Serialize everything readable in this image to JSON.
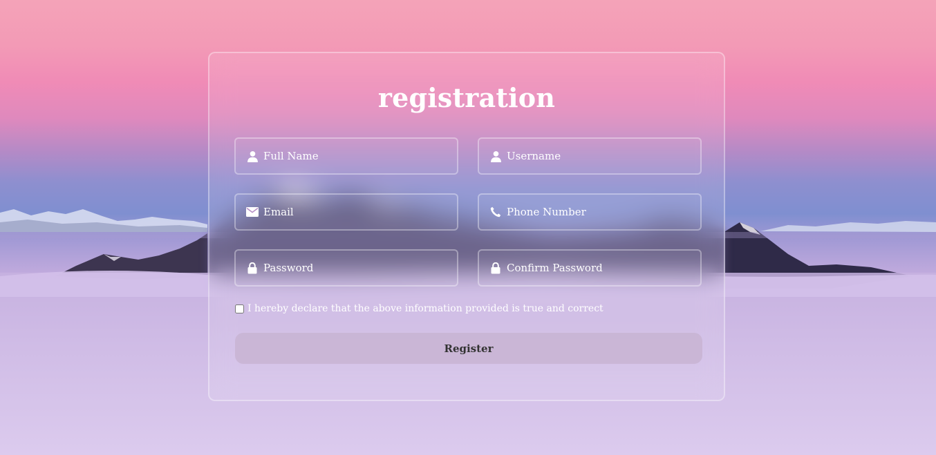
{
  "form": {
    "title": "registration",
    "fields": [
      {
        "icon": "user-icon",
        "placeholder": "Full Name",
        "value": ""
      },
      {
        "icon": "user-icon",
        "placeholder": "Username",
        "value": ""
      },
      {
        "icon": "envelope-icon",
        "placeholder": "Email",
        "value": ""
      },
      {
        "icon": "phone-icon",
        "placeholder": "Phone Number",
        "value": ""
      },
      {
        "icon": "lock-icon",
        "placeholder": "Password",
        "value": ""
      },
      {
        "icon": "lock-icon",
        "placeholder": "Confirm Password",
        "value": ""
      }
    ],
    "declaration": {
      "label": "I hereby declare that the above information provided is true and correct",
      "checked": false
    },
    "submit_label": "Register"
  },
  "colors": {
    "text": "#ffffff",
    "button_background": "#c8b4d2",
    "button_text": "#333333"
  }
}
